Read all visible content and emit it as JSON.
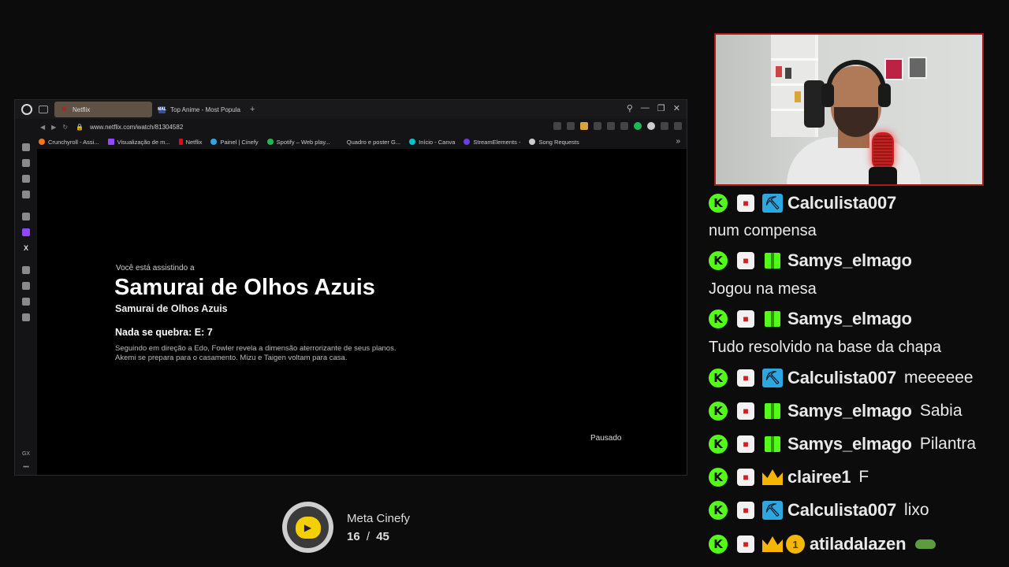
{
  "browser": {
    "tabs": [
      {
        "label": "Netflix",
        "favicon": "netflix-icon",
        "active": true
      },
      {
        "label": "Top Anime - Most Popula",
        "favicon": "myanimelist-icon",
        "active": false
      }
    ],
    "url": "www.netflix.com/watch/81304582",
    "bookmarks": [
      {
        "label": "Crunchyroll - Assi...",
        "color": "#f47521"
      },
      {
        "label": "Visualização de m...",
        "color": "#9146ff"
      },
      {
        "label": "Netflix",
        "color": "#e50914"
      },
      {
        "label": "Painel | Cinefy",
        "color": "#2ea7e0"
      },
      {
        "label": "Spotify – Web play...",
        "color": "#1db954"
      },
      {
        "label": "Quadro e poster G...",
        "color": "#000000"
      },
      {
        "label": "Início - Canva",
        "color": "#00c4cc"
      },
      {
        "label": "StreamElements -",
        "color": "#6a3de8"
      },
      {
        "label": "Song Requests",
        "color": "#cccccc"
      }
    ]
  },
  "player": {
    "watching_label": "Você está assistindo a",
    "title": "Samurai de Olhos Azuis",
    "subtitle": "Samurai de Olhos Azuis",
    "episode": "Nada se quebra: E: 7",
    "description": "Seguindo em direção a Edo, Fowler revela a dimensão aterrorizante de seus planos. Akemi se prepara para o casamento. Mizu e Taigen voltam para casa.",
    "status": "Pausado"
  },
  "chat": {
    "messages": [
      {
        "user": "Calculista007",
        "badge": "mod",
        "text": "num compensa",
        "text_below": true
      },
      {
        "user": "Samys_elmago",
        "badge": "gift",
        "text": "Jogou na mesa",
        "text_below": true
      },
      {
        "user": "Samys_elmago",
        "badge": "gift",
        "text": "Tudo resolvido na base da chapa",
        "text_below": true
      },
      {
        "user": "Calculista007",
        "badge": "mod",
        "text": "meeeeee",
        "text_below": false
      },
      {
        "user": "Samys_elmago",
        "badge": "gift",
        "text": "Sabia",
        "text_below": false
      },
      {
        "user": "Samys_elmago",
        "badge": "gift",
        "text": "Pilantra",
        "text_below": false
      },
      {
        "user": "clairee1",
        "badge": "crown",
        "text": "F",
        "text_below": false
      },
      {
        "user": "Calculista007",
        "badge": "mod",
        "text": "lixo",
        "text_below": false
      },
      {
        "user": "atiladalazen",
        "badge": "crown",
        "coin": "1",
        "text": "",
        "emote": "pepe-frog-emote",
        "text_below": false
      }
    ]
  },
  "goal": {
    "title": "Meta Cinefy",
    "current": "16",
    "separator": "/",
    "target": "45",
    "icon": "cinefy-popcorn-icon",
    "progress_fraction": 0.356
  },
  "colors": {
    "kick_green": "#53fc18",
    "mod_blue": "#2ea7e0",
    "crown_gold": "#f5b400",
    "netflix_red": "#e50914",
    "webcam_border": "#a31d1d"
  }
}
